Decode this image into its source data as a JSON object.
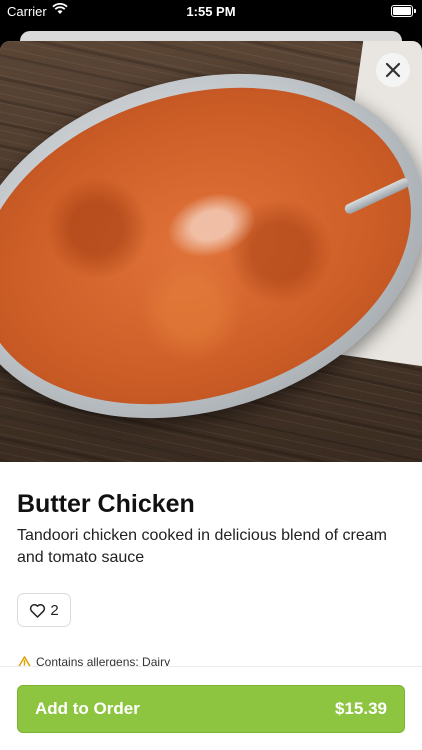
{
  "status_bar": {
    "carrier": "Carrier",
    "time": "1:55 PM"
  },
  "item": {
    "name": "Butter Chicken",
    "description": "Tandoori chicken cooked in delicious blend of cream and tomato sauce",
    "likes": "2",
    "allergens": "Contains allergens: Dairy"
  },
  "order_button": {
    "label": "Add to Order",
    "price": "$15.39"
  },
  "icons": {
    "close": "close-icon",
    "like": "heart-icon",
    "warning": "warning-icon",
    "wifi": "wifi-icon",
    "battery": "battery-icon"
  },
  "colors": {
    "accent": "#8dc540",
    "warning": "#e0a100"
  }
}
